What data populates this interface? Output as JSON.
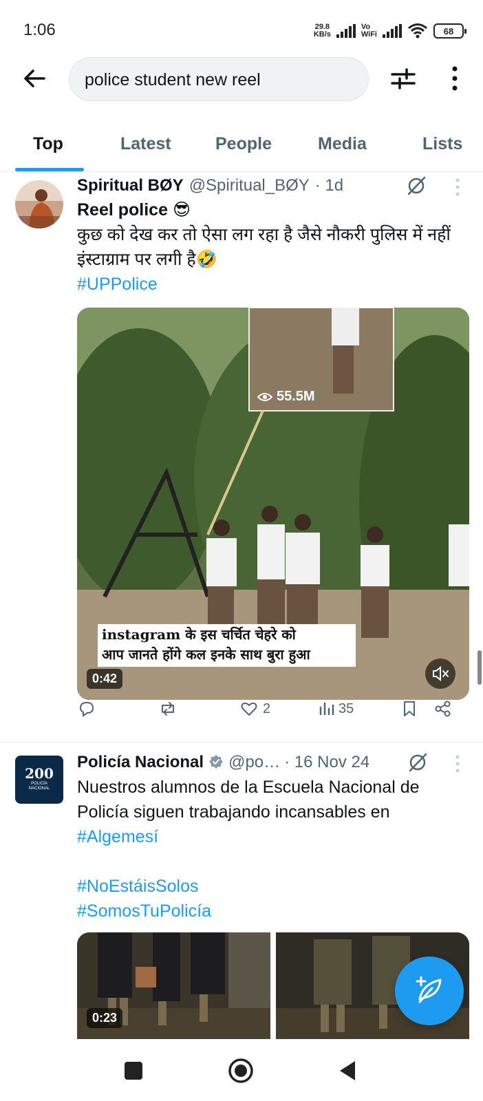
{
  "status_bar": {
    "time": "1:06",
    "net_speed_value": "29.8",
    "net_speed_unit": "KB/s",
    "vowifi_line1": "Vo",
    "vowifi_line2": "WiFi",
    "battery": "68"
  },
  "header": {
    "search_value": "police student new reel",
    "back_icon": "arrow-left-icon",
    "filter_icon": "sliders-icon",
    "more_icon": "vertical-dots-icon"
  },
  "tabs": [
    {
      "label": "Top",
      "active": true
    },
    {
      "label": "Latest",
      "active": false
    },
    {
      "label": "People",
      "active": false
    },
    {
      "label": "Media",
      "active": false
    },
    {
      "label": "Lists",
      "active": false
    }
  ],
  "posts": [
    {
      "author_name": "Spiritual BØY",
      "handle": "@Spiritual_BØY",
      "time": "· 1d",
      "title": "Reel police 😎",
      "text_line1": "कुछ को देख कर तो ऐसा लग रहा है जैसे नौकरी पुलिस में नहीं",
      "text_line2": "इंस्टाग्राम पर लगी है🤣",
      "hashtag": "#UPPolice",
      "video": {
        "views_overlay": "55.5M",
        "caption_line1": "instagram के इस चर्चित चेहरे को",
        "caption_line2": "आप जानते होंगे कल इनके साथ बुरा हुआ",
        "duration": "0:42"
      },
      "actions": {
        "reply_count": "",
        "repost_count": "",
        "like_count": "2",
        "views_count": "35"
      }
    },
    {
      "author_name": "Policía Nacional",
      "verified": true,
      "handle": "@po…",
      "time": "· 16 Nov 24",
      "logo_text": "200",
      "logo_sub1": "POLICÍA",
      "logo_sub2": "NACIONAL",
      "text_line1": "Nuestros alumnos de la Escuela Nacional de",
      "text_line2": "Policía siguen trabajando incansables en",
      "hashtag1": "#Algemesí",
      "hashtag2": "#NoEstáisSolos",
      "hashtag3": "#SomosTuPolicía",
      "video": {
        "duration": "0:23"
      }
    }
  ],
  "colors": {
    "accent": "#1d9bf0",
    "text_primary": "#0f1419",
    "text_secondary": "#536471"
  }
}
